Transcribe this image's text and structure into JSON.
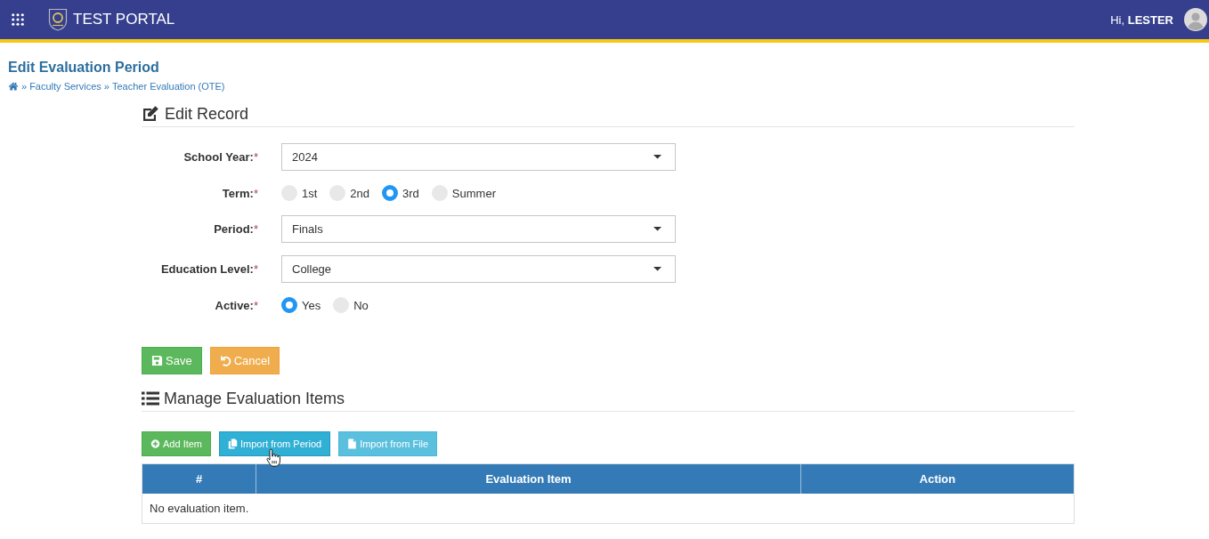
{
  "top_bar": {
    "app_title": "TEST PORTAL",
    "greeting": "Hi, **LESTER**"
  },
  "page": {
    "title": "Edit Evaluation Period",
    "breadcrumb": [
      {
        "kind": "separator",
        "text": "»"
      },
      {
        "kind": "link",
        "text": "Faculty Services"
      },
      {
        "kind": "separator",
        "text": "»"
      },
      {
        "kind": "link",
        "text": "Teacher Evaluation (OTE)"
      }
    ]
  },
  "edit_record": {
    "title": "Edit Record",
    "fields": [
      {
        "kind": "select",
        "label": "School Year:",
        "required_mark": "*",
        "value": "2024"
      },
      {
        "kind": "radio",
        "label": "Term:",
        "required_mark": "*",
        "options": [
          {
            "label": "1st",
            "selected": false
          },
          {
            "label": "2nd",
            "selected": false
          },
          {
            "label": "3rd",
            "selected": true
          },
          {
            "label": "Summer",
            "selected": false
          }
        ]
      },
      {
        "kind": "select",
        "label": "Period:",
        "required_mark": "*",
        "value": "Finals"
      },
      {
        "kind": "select",
        "label": "Education Level:",
        "required_mark": "*",
        "value": "College"
      },
      {
        "kind": "radio",
        "label": "Active:",
        "required_mark": "*",
        "options": [
          {
            "label": "Yes",
            "selected": true
          },
          {
            "label": "No",
            "selected": false
          }
        ]
      }
    ],
    "actions": [
      {
        "kind": "save",
        "label": "Save"
      },
      {
        "kind": "cancel",
        "label": "Cancel"
      }
    ]
  },
  "evaluation_items": {
    "title": "Manage Evaluation Items",
    "actions": [
      {
        "kind": "add",
        "label": "Add Item",
        "hovered": false
      },
      {
        "kind": "import-period",
        "label": "Import from Period",
        "hovered": true
      },
      {
        "kind": "import-file",
        "label": "Import from File",
        "hovered": false
      }
    ],
    "table": {
      "columns": [
        "#",
        "Evaluation Item",
        "Action"
      ],
      "empty_message": "No evaluation item."
    }
  }
}
